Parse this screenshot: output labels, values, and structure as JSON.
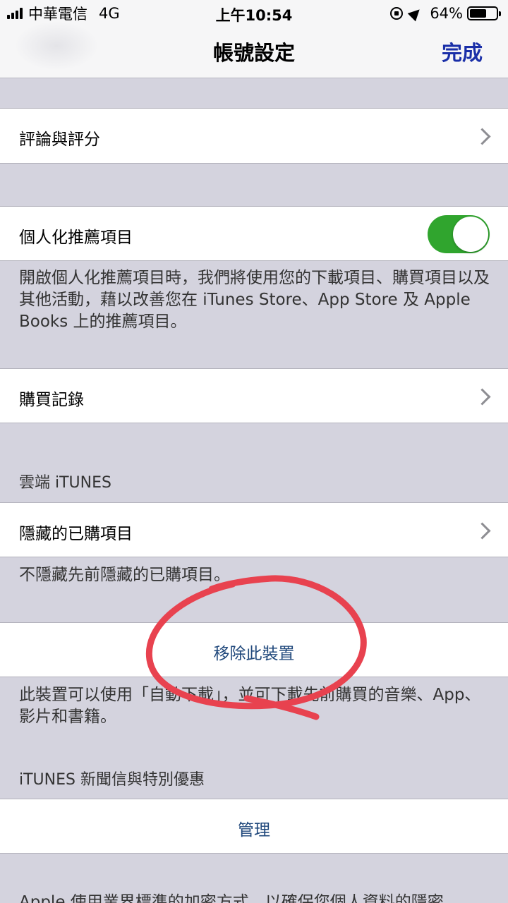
{
  "status": {
    "carrier": "中華電信",
    "network": "4G",
    "time": "上午10:54",
    "battery": "64%",
    "battery_level": 0.64
  },
  "nav": {
    "title": "帳號設定",
    "done": "完成"
  },
  "rows": {
    "ratings": "評論與評分",
    "personalized": "個人化推薦項目",
    "personalized_on": true,
    "personalized_desc": "開啟個人化推薦項目時，我們將使用您的下載項目、購買項目以及其他活動，藉以改善您在 iTunes Store、App Store 及 Apple Books 上的推薦項目。",
    "purchase_history": "購買記錄",
    "cloud_header": "雲端 iTUNES",
    "hidden_purchases": "隱藏的已購項目",
    "hidden_desc": "不隱藏先前隱藏的已購項目。",
    "remove_device": "移除此裝置",
    "remove_desc": "此裝置可以使用「自動下載」，並可下載先前購買的音樂、App、影片和書籍。",
    "newsletter_header": "iTUNES 新聞信與特別優惠",
    "manage": "管理",
    "footer_partial": "Apple 使用業界標準的加密方式，以確保您個人資料的隱密"
  },
  "colors": {
    "accent": "#1a2fa8",
    "link": "#21497c",
    "toggle_on": "#30a52e",
    "annotation": "#e8424f"
  }
}
